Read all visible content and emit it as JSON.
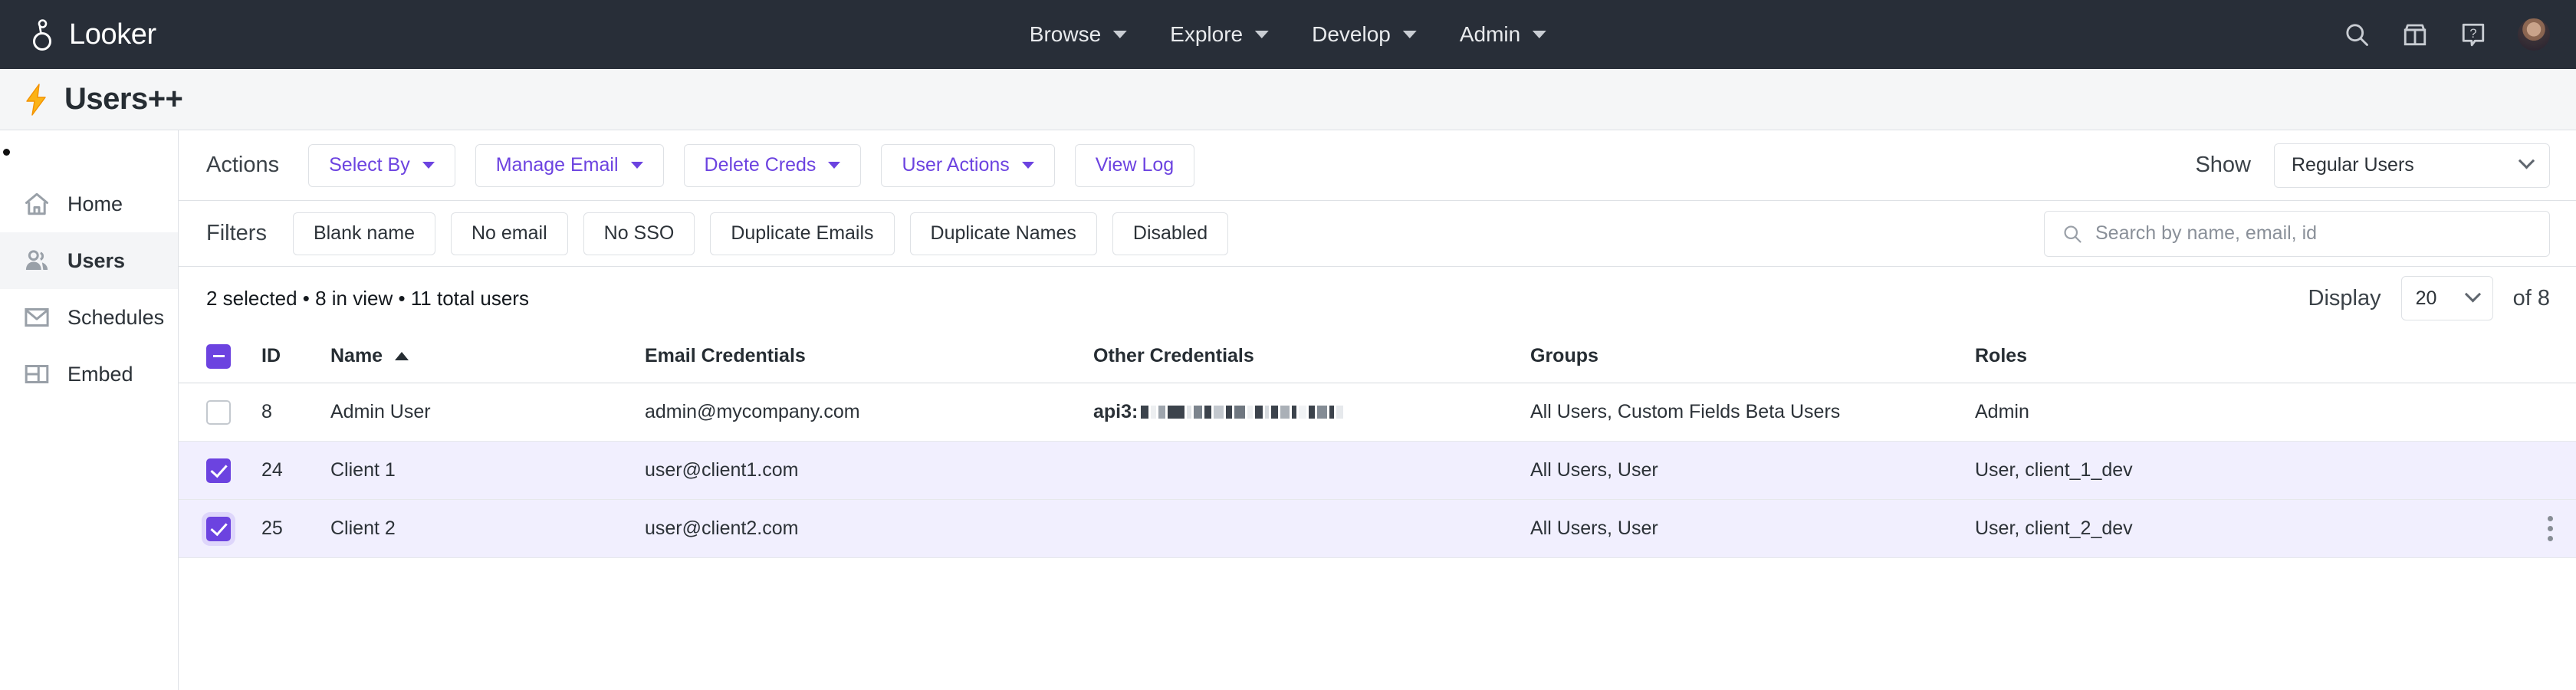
{
  "topbar": {
    "brand": "Looker",
    "nav": [
      {
        "label": "Browse"
      },
      {
        "label": "Explore"
      },
      {
        "label": "Develop"
      },
      {
        "label": "Admin"
      }
    ],
    "icons": {
      "search": "search-icon",
      "marketplace": "marketplace-icon",
      "help": "help-icon",
      "avatar": "user-avatar"
    }
  },
  "page": {
    "title": "Users++",
    "icon": "lightning-bolt-icon"
  },
  "sidebar": {
    "items": [
      {
        "label": "Home",
        "icon": "home-icon",
        "active": false
      },
      {
        "label": "Users",
        "icon": "users-icon",
        "active": true
      },
      {
        "label": "Schedules",
        "icon": "envelope-icon",
        "active": false
      },
      {
        "label": "Embed",
        "icon": "embed-icon",
        "active": false
      }
    ]
  },
  "toolbar": {
    "label": "Actions",
    "buttons": [
      {
        "label": "Select By",
        "has_caret": true
      },
      {
        "label": "Manage Email",
        "has_caret": true
      },
      {
        "label": "Delete Creds",
        "has_caret": true
      },
      {
        "label": "User Actions",
        "has_caret": true
      },
      {
        "label": "View Log",
        "has_caret": false
      }
    ],
    "show_label": "Show",
    "show_value": "Regular Users"
  },
  "filters": {
    "label": "Filters",
    "chips": [
      {
        "label": "Blank name"
      },
      {
        "label": "No email"
      },
      {
        "label": "No SSO"
      },
      {
        "label": "Duplicate Emails"
      },
      {
        "label": "Duplicate Names"
      },
      {
        "label": "Disabled"
      }
    ]
  },
  "search": {
    "placeholder": "Search by name, email, id",
    "value": ""
  },
  "status": {
    "summary": "2 selected • 8 in view • 11 total users",
    "display_label": "Display",
    "display_value": "20",
    "of_label": "of 8"
  },
  "table": {
    "columns": {
      "id": "ID",
      "name": "Name",
      "email": "Email Credentials",
      "other": "Other Credentials",
      "groups": "Groups",
      "roles": "Roles"
    },
    "sort": {
      "column": "Name",
      "direction": "asc"
    },
    "header_checkbox_state": "indeterminate",
    "rows": [
      {
        "selected": false,
        "id": "8",
        "name": "Admin User",
        "email": "admin@mycompany.com",
        "other_prefix": "api3:",
        "other_redacted": true,
        "groups": "All Users, Custom Fields Beta Users",
        "roles": "Admin",
        "kebab": false
      },
      {
        "selected": true,
        "id": "24",
        "name": "Client 1",
        "email": "user@client1.com",
        "other_prefix": "",
        "other_redacted": false,
        "groups": "All Users, User",
        "roles": "User, client_1_dev",
        "kebab": false
      },
      {
        "selected": true,
        "id": "25",
        "name": "Client 2",
        "email": "user@client2.com",
        "other_prefix": "",
        "other_redacted": false,
        "groups": "All Users, User",
        "roles": "User, client_2_dev",
        "kebab": true
      }
    ]
  },
  "colors": {
    "topbar_bg": "#282E38",
    "accent_purple": "#6C43E0",
    "selected_row_bg": "#F1EFFE",
    "bolt_yellow": "#F5A623",
    "title_band_bg": "#F5F6F7"
  }
}
